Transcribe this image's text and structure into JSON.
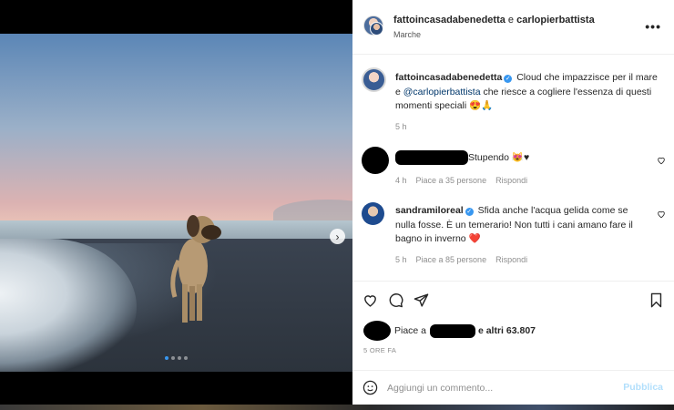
{
  "post": {
    "header": {
      "users_primary": "fattoincasadabenedetta",
      "users_joiner": " e ",
      "users_secondary": "carlopierbattista",
      "location": "Marche",
      "more_glyph": "•••"
    },
    "caption": {
      "username": "fattoincasadabenedetta",
      "text_before": " Cloud che impazzisce per il mare e ",
      "mention": "@carlopierbattista",
      "text_after": " che riesce a cogliere l'essenza di questi momenti speciali 😍🙏",
      "time": "5 h"
    },
    "comments": [
      {
        "username": "",
        "text": "Stupendo 😻♥",
        "time": "4 h",
        "likes": "Piace a 35 persone",
        "reply": "Rispondi"
      },
      {
        "username": "sandramiloreal",
        "text": " Sfida anche l'acqua gelida come se nulla fosse. È un temerario! Non tutti i cani amano fare il bagno in inverno ❤️",
        "time": "5 h",
        "likes": "Piace a 85 persone",
        "reply": "Rispondi"
      }
    ],
    "likes": {
      "prefix": "Piace a",
      "suffix": " e altri 63.807"
    },
    "posted_when": "5 ORE FA",
    "comment_box": {
      "placeholder": "Aggiungi un commento...",
      "publish_label": "Pubblica"
    },
    "carousel": {
      "total": 4,
      "active_index": 0
    }
  },
  "colors": {
    "accent": "#3897f0",
    "mention": "#00376b",
    "muted": "#8e8e8e",
    "publish_disabled": "#b2dffc"
  },
  "icons": [
    "chevron-right-icon",
    "heart-icon",
    "comment-icon",
    "share-icon",
    "bookmark-icon",
    "emoji-icon",
    "verified-icon",
    "more-icon"
  ]
}
